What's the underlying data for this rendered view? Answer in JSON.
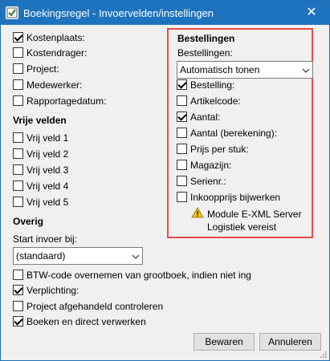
{
  "window": {
    "title": "Boekingsregel - Invoervelden/instellingen",
    "close": "✕"
  },
  "left": {
    "fields": [
      {
        "label": "Kostenplaats:",
        "checked": true
      },
      {
        "label": "Kostendrager:",
        "checked": false
      },
      {
        "label": "Project:",
        "checked": false
      },
      {
        "label": "Medewerker:",
        "checked": false
      },
      {
        "label": "Rapportagedatum:",
        "checked": false
      }
    ],
    "free_fields_title": "Vrije velden",
    "free_fields": [
      {
        "label": "Vrij veld 1",
        "checked": false
      },
      {
        "label": "Vrij veld 2",
        "checked": false
      },
      {
        "label": "Vrij veld 3",
        "checked": false
      },
      {
        "label": "Vrij veld 4",
        "checked": false
      },
      {
        "label": "Vrij veld 5",
        "checked": false
      }
    ],
    "other_title": "Overig",
    "start_label": "Start invoer bij:",
    "start_value": "(standaard)",
    "other_options": [
      {
        "label": "BTW-code overnemen van grootboek, indien niet ing",
        "checked": false
      },
      {
        "label": "Verplichting:",
        "checked": true
      },
      {
        "label": "Project afgehandeld controleren",
        "checked": false
      },
      {
        "label": "Boeken en direct verwerken",
        "checked": true
      }
    ]
  },
  "right": {
    "title": "Bestellingen",
    "orders_label": "Bestellingen:",
    "orders_value": "Automatisch tonen",
    "options": [
      {
        "label": "Bestelling:",
        "checked": true
      },
      {
        "label": "Artikelcode:",
        "checked": false
      },
      {
        "label": "Aantal:",
        "checked": true
      },
      {
        "label": "Aantal (berekening):",
        "checked": false
      },
      {
        "label": "Prijs per stuk:",
        "checked": false
      },
      {
        "label": "Magazijn:",
        "checked": false
      },
      {
        "label": "Serienr.:",
        "checked": false
      },
      {
        "label": "Inkoopprijs bijwerken",
        "checked": false
      }
    ],
    "warning_line1": "Module E-XML Server",
    "warning_line2": "Logistiek vereist",
    "highlight_color": "#e64b4b"
  },
  "buttons": {
    "save": "Bewaren",
    "cancel": "Annuleren"
  },
  "colors": {
    "titlebar": "#1e73be",
    "background": "#f0f0f0"
  }
}
